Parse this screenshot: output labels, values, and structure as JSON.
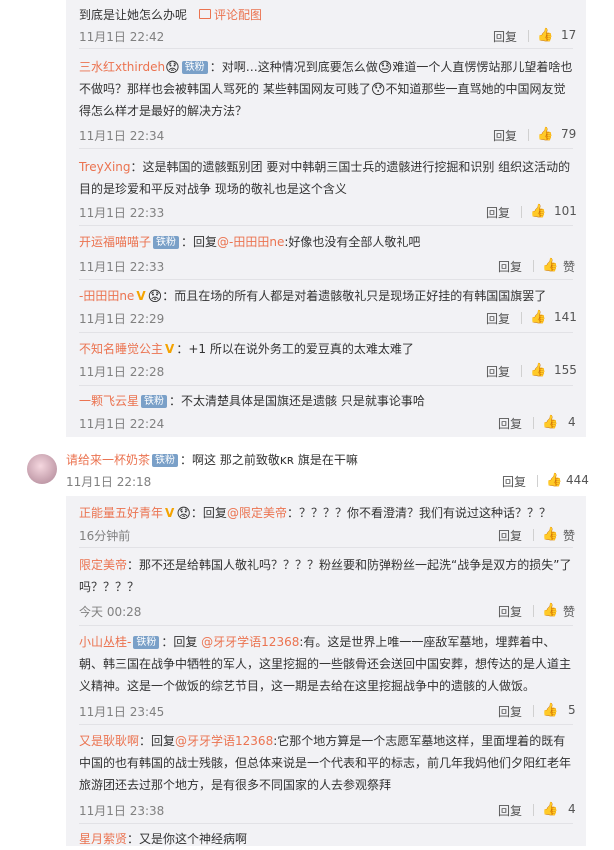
{
  "thread1": [
    {
      "pre": "",
      "name": "",
      "badge": "",
      "vip": "",
      "text": "到底是让她怎么办呢",
      "link": "评论配图",
      "time": "11月1日 22:42",
      "reply": "回复",
      "likes": "17"
    },
    {
      "name": "三水红xthirdeh",
      "vip": "V",
      "emoji1": "😟",
      "badge": "铁粉",
      "text1": "：对啊…这种情况到底要怎么做",
      "emoji2": "😓",
      "text2": "难道一个人直愣愣站那儿望着啥也不做吗？那样也会被韩国人骂死的 某些韩国网友可贱了",
      "emoji3": "😯",
      "text3": "不知道那些一直骂她的中国网友觉得怎么样才是最好的解决方法？",
      "time": "11月1日 22:34",
      "reply": "回复",
      "likes": "79"
    },
    {
      "name": "TreyXing",
      "text": "：这是韩国的遗骸甄别团 要对中韩朝三国士兵的遗骸进行挖掘和识别 组织这活动的目的是珍爱和平反对战争 现场的敬礼也是这个含义",
      "time": "11月1日 22:33",
      "reply": "回复",
      "likes": "101"
    },
    {
      "name": "开运福喵喵子",
      "badge": "铁粉",
      "pre": "：回复",
      "at": "@-田田田ne",
      "text": ":好像也没有全部人敬礼吧",
      "time": "11月1日 22:33",
      "reply": "回复",
      "likes": "赞"
    },
    {
      "name": "-田田田ne",
      "vip": "V",
      "emoji1": "😟",
      "text": "：而且在场的所有人都是对着遗骸敬礼只是现场正好挂的有韩国国旗罢了",
      "time": "11月1日 22:29",
      "reply": "回复",
      "likes": "141"
    },
    {
      "name": "不知名睡觉公主",
      "vip": "V",
      "text": "：+1 所以在说外务工的爱豆真的太难太难了",
      "time": "11月1日 22:28",
      "reply": "回复",
      "likes": "155"
    },
    {
      "name": "一颗飞云星",
      "badge": "铁粉",
      "text": "：不太清楚具体是国旗还是遗骸 只是就事论事哈",
      "time": "11月1日 22:24",
      "reply": "回复",
      "likes": "4"
    }
  ],
  "top_comment": {
    "name": "请给来一杯奶茶",
    "badge": "铁粉",
    "text": "：啊这 那之前致敬ᴋʀ 旗是在干嘛",
    "time": "11月1日 22:18",
    "reply": "回复",
    "likes": "444"
  },
  "thread2": [
    {
      "name": "正能量五好青年",
      "vip": "V",
      "emoji1": "😟",
      "pre": "：回复",
      "at": "@限定美帝",
      "text": "：？？？？你不看澄清？我们有说过这种话？？？",
      "time": "16分钟前",
      "reply": "回复",
      "likes": "赞"
    },
    {
      "name": "限定美帝",
      "text": "：那不还是给韩国人敬礼吗？？？？粉丝要和防弹粉丝一起洗“战争是双方的损失”了吗？？？？",
      "time": "今天 00:28",
      "reply": "回复",
      "likes": "赞"
    },
    {
      "name": "小山丛桂-",
      "badge": "铁粉",
      "pre": "：回复 ",
      "at": "@牙牙学语12368",
      "text": ":有。这是世界上唯一一座敌军墓地，埋葬着中、朝、韩三国在战争中牺牲的军人，这里挖掘的一些骸骨还会送回中国安葬，想传达的是人道主义精神。这是一个做饭的综艺节目，这一期是去给在这里挖掘战争中的遗骸的人做饭。",
      "time": "11月1日 23:45",
      "reply": "回复",
      "likes": "5"
    },
    {
      "name": "又是耿耿啊",
      "pre": "：回复",
      "at": "@牙牙学语12368",
      "text": ":它那个地方算是一个志愿军墓地这样，里面埋着的既有中国的也有韩国的战士残骸，但总体来说是一个代表和平的标志，前几年我妈他们夕阳红老年旅游团还去过那个地方，是有很多不同国家的人去参观祭拜",
      "time": "11月1日 23:38",
      "reply": "回复",
      "likes": "4"
    },
    {
      "name": "星月萦贤",
      "text": "：又是你这个神经病啊"
    }
  ]
}
